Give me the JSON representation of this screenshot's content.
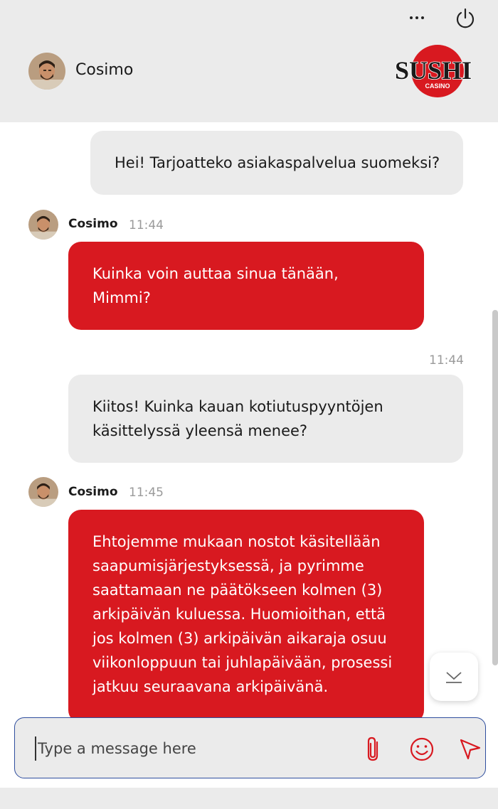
{
  "header": {
    "agent_name": "Cosimo",
    "brand": {
      "name": "SUSHI",
      "sub": "CASINO"
    }
  },
  "messages": [
    {
      "sender": "user",
      "text": "Hei! Tarjoatteko asiakaspalvelua suomeksi?"
    },
    {
      "sender": "agent",
      "name": "Cosimo",
      "time": "11:44",
      "text": "Kuinka voin auttaa sinua tänään, Mimmi?"
    },
    {
      "sender": "user",
      "time": "11:44",
      "text": "Kiitos! Kuinka kauan kotiutuspyyntöjen käsittelyssä yleensä menee?"
    },
    {
      "sender": "agent",
      "name": "Cosimo",
      "time": "11:45",
      "text": "Ehtojemme mukaan nostot käsitellään saapumisjärjestyksessä, ja pyrimme saattamaan ne päätökseen kolmen (3) arkipäivän kuluessa. Huomioithan, että jos kolmen (3) arkipäivän aikaraja osuu viikonloppuun tai juhlapäivään, prosessi jatkuu seuraavana arkipäivänä."
    }
  ],
  "composer": {
    "placeholder": "Type a message here",
    "value": ""
  },
  "colors": {
    "accent": "#d81920",
    "user_bubble": "#ebebeb",
    "header_bg": "#ebebeb",
    "input_border": "#2f4e9e"
  },
  "icons": [
    "more-icon",
    "power-icon",
    "attach-icon",
    "emoji-icon",
    "send-icon",
    "chevron-down-icon"
  ]
}
